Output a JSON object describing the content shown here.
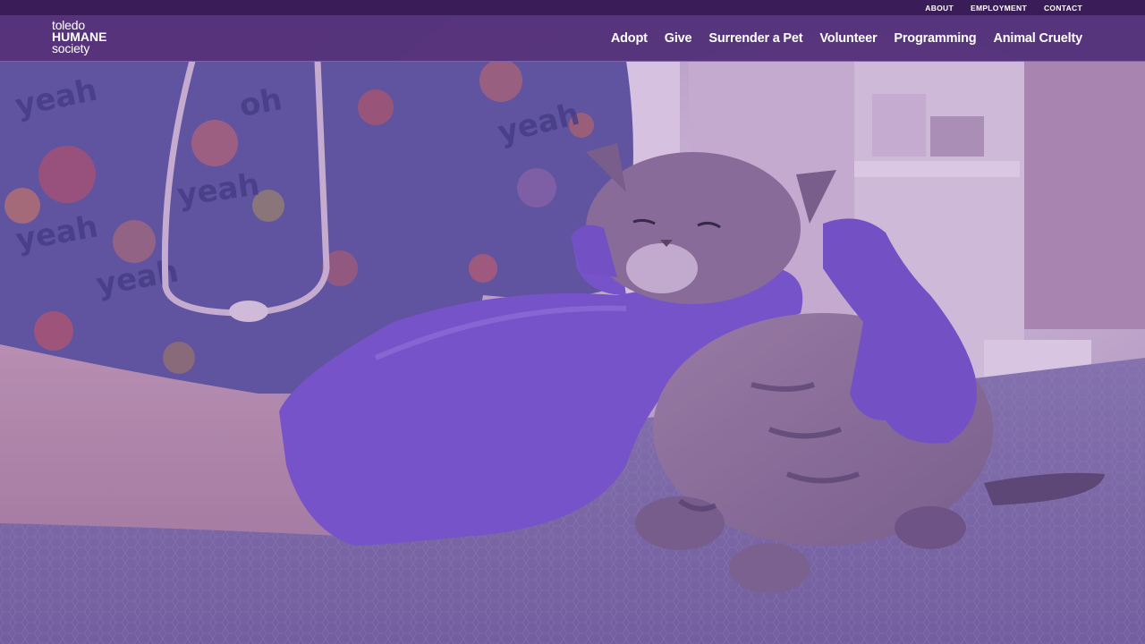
{
  "header": {
    "logo": {
      "line1": "toledo",
      "line2": "HUMANE",
      "line3": "society"
    },
    "utility_links": [
      "ABOUT",
      "EMPLOYMENT",
      "CONTACT"
    ],
    "nav_items": [
      "Adopt",
      "Give",
      "Surrender a Pet",
      "Volunteer",
      "Programming",
      "Animal Cruelty"
    ]
  },
  "hero": {
    "overlay_color": "#6a3fa0",
    "scrubs_text": "yeah"
  },
  "colors": {
    "utility_bar": "#3a1d58",
    "header_bg": "#502d76",
    "glove": "#7b5ad6",
    "table": "#7d70a8"
  }
}
